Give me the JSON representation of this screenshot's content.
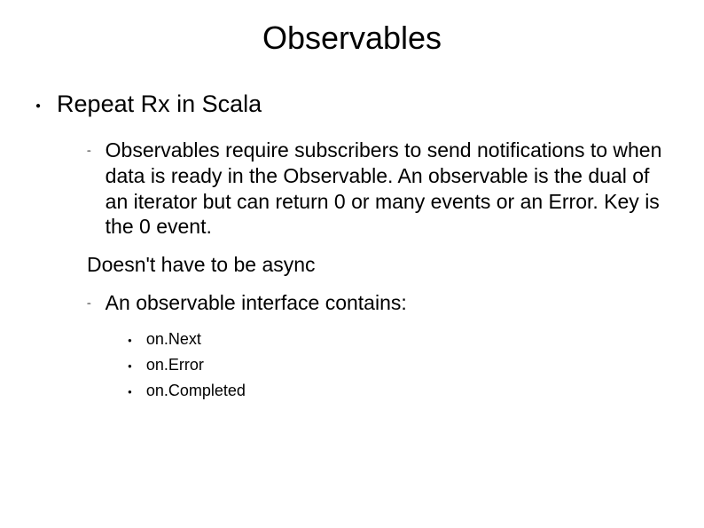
{
  "title": "Observables",
  "level1": {
    "heading": "Repeat Rx in Scala"
  },
  "level2": {
    "item1": "Observables require subscribers to send notifications to when data is ready in the Observable. An observable is the dual of an iterator but can return 0 or many events or an Error. Key is the 0 event.",
    "plain": "Doesn't have to be async",
    "item2": "An observable interface contains:"
  },
  "level3": {
    "item1": "on.Next",
    "item2": "on.Error",
    "item3": "on.Completed"
  }
}
